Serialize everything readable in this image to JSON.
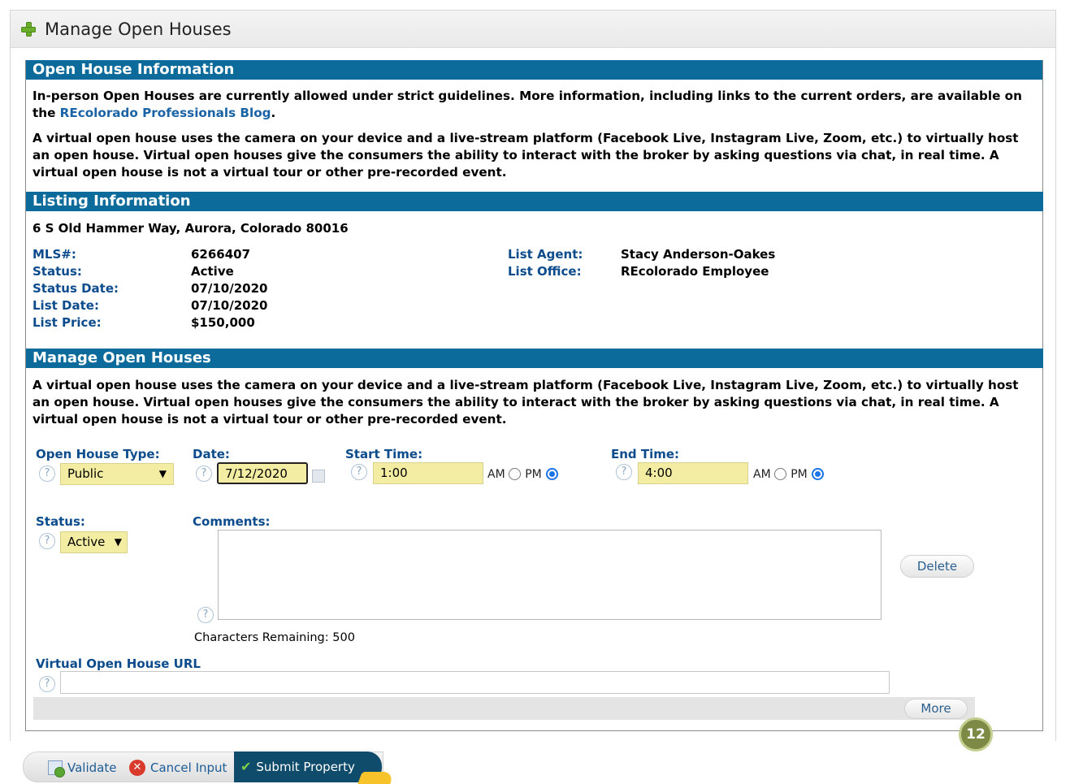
{
  "page": {
    "title": "Manage Open Houses"
  },
  "info_section": {
    "header": "Open House Information",
    "para1_text": "In-person Open Houses are currently allowed under strict guidelines. More information, including links to the current orders, are available on the ",
    "para1_link": "REcolorado Professionals Blog",
    "para1_end": ".",
    "para2": "A virtual open house uses the camera on your device and a live-stream platform (Facebook Live, Instagram Live, Zoom, etc.) to virtually host an open house. Virtual open houses give the consumers the ability to interact with the broker by asking questions via chat, in real time. A virtual open house is not a virtual tour or other pre-recorded event."
  },
  "listing_section": {
    "header": "Listing Information",
    "address": "6 S Old Hammer Way, Aurora, Colorado 80016",
    "fields_left": [
      {
        "label": "MLS#:",
        "value": "6266407"
      },
      {
        "label": "Status:",
        "value": "Active"
      },
      {
        "label": "Status Date:",
        "value": "07/10/2020"
      },
      {
        "label": "List Date:",
        "value": "07/10/2020"
      },
      {
        "label": "List Price:",
        "value": "$150,000"
      }
    ],
    "fields_right": [
      {
        "label": "List Agent:",
        "value": "Stacy Anderson-Oakes"
      },
      {
        "label": "List Office:",
        "value": "REcolorado Employee"
      }
    ]
  },
  "manage_section": {
    "header": "Manage Open Houses",
    "para": "A virtual open house uses the camera on your device and a live-stream platform (Facebook Live, Instagram Live, Zoom, etc.) to virtually host an open house. Virtual open houses give the consumers the ability to interact with the broker by asking questions via chat, in real time. A virtual open house is not a virtual tour or other pre-recorded event.",
    "type_label": "Open House Type:",
    "type_value": "Public",
    "date_label": "Date:",
    "date_value": "7/12/2020",
    "start_label": "Start Time:",
    "start_value": "1:00",
    "end_label": "End Time:",
    "end_value": "4:00",
    "am_label": "AM",
    "pm_label": "PM",
    "start_ampm": "PM",
    "end_ampm": "PM",
    "status_label": "Status:",
    "status_value": "Active",
    "comments_label": "Comments:",
    "comments_value": "",
    "chars_remaining": "Characters Remaining: 500",
    "delete_label": "Delete",
    "url_label": "Virtual Open House URL",
    "url_value": "",
    "more_label": "More",
    "help_glyph": "?"
  },
  "bottom_bar": {
    "validate_label": "Validate",
    "cancel_label": "Cancel Input",
    "submit_label": "Submit Property",
    "badge_number": "12"
  },
  "colors": {
    "section_header": "#0d6b9c",
    "label_blue": "#0d4c8c",
    "field_yellow": "#f3eda3",
    "submit_bg": "#0f4c6c"
  }
}
